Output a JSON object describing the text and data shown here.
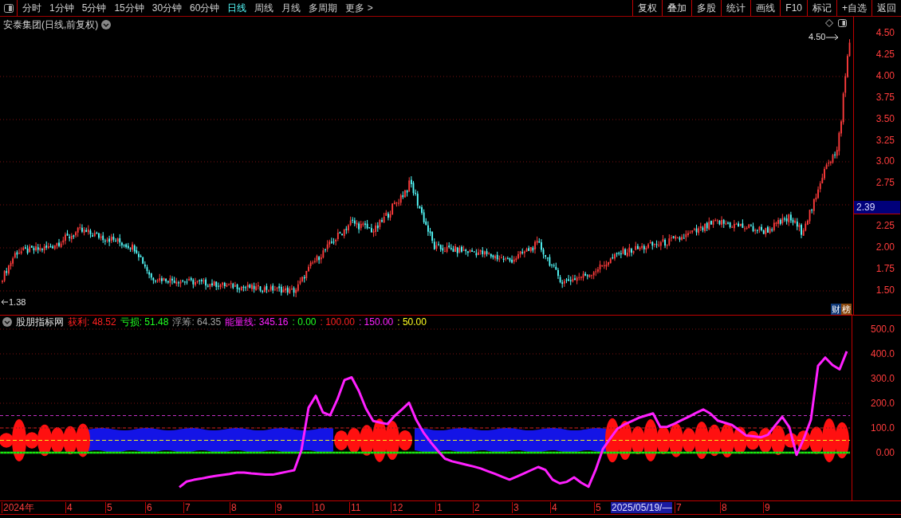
{
  "toolbar": {
    "periods": [
      {
        "label": "分时",
        "selected": false
      },
      {
        "label": "1分钟",
        "selected": false
      },
      {
        "label": "5分钟",
        "selected": false
      },
      {
        "label": "15分钟",
        "selected": false
      },
      {
        "label": "30分钟",
        "selected": false
      },
      {
        "label": "60分钟",
        "selected": false
      },
      {
        "label": "日线",
        "selected": true
      },
      {
        "label": "周线",
        "selected": false
      },
      {
        "label": "月线",
        "selected": false
      },
      {
        "label": "多周期",
        "selected": false
      },
      {
        "label": "更多 >",
        "selected": false
      }
    ],
    "actions": [
      "复权",
      "叠加",
      "多股",
      "统计",
      "画线",
      "F10",
      "标记",
      "+自选",
      "返回"
    ]
  },
  "price_chart": {
    "title": "安泰集团(日线,前复权)",
    "ticks": [
      "4.50",
      "4.25",
      "4.00",
      "3.75",
      "3.50",
      "3.25",
      "3.00",
      "2.75",
      "2.25",
      "2.00",
      "1.75",
      "1.50"
    ],
    "current_price": "2.39",
    "high_label": "4.50",
    "low_label": "1.38",
    "badge": [
      "财",
      "榜"
    ]
  },
  "indicator": {
    "name": "股朋指标网",
    "readings": [
      {
        "kind": "plain",
        "label": "获利",
        "value": ": 48.52",
        "color": "#ff2020"
      },
      {
        "kind": "plain",
        "label": "亏损",
        "value": ": 51.48",
        "color": "#20ff20"
      },
      {
        "kind": "plain",
        "label": "浮筹",
        "value": ": 64.35",
        "color": "#a0a0a0"
      },
      {
        "kind": "series",
        "value": ": 345.16",
        "color": "#ff20ff"
      },
      {
        "kind": "plain",
        "value": ": 0.00",
        "color": "#20ff20"
      },
      {
        "kind": "plain",
        "value": ": 100.00",
        "color": "#ff2020"
      },
      {
        "kind": "plain",
        "value": ": 150.00",
        "color": "#ff20ff"
      },
      {
        "kind": "plain",
        "value": ": 50.00",
        "color": "#ffff20"
      }
    ],
    "chart_data": {
      "type": "line",
      "grid": true,
      "ylim": [
        -193.5,
        506.5
      ],
      "yticks": [
        {
          "value": 500,
          "label": "500.0"
        },
        {
          "value": 400,
          "label": "400.0"
        },
        {
          "value": 300,
          "label": "300.0"
        },
        {
          "value": 200,
          "label": "200.0"
        },
        {
          "value": 100,
          "label": "100.0"
        },
        {
          "value": 0,
          "label": "0.00"
        }
      ],
      "series": [
        {
          "name": "能量线",
          "color": "#ff20ff",
          "values": [
            null,
            null,
            null,
            null,
            null,
            null,
            null,
            null,
            null,
            null,
            null,
            null,
            null,
            null,
            null,
            null,
            null,
            null,
            null,
            null,
            null,
            null,
            null,
            null,
            null,
            -140,
            -117,
            -110,
            -105,
            -99,
            -94,
            -90,
            -86,
            -81,
            -81,
            -84,
            -86,
            -89,
            -89,
            -83,
            -77,
            -71,
            10,
            182,
            230,
            163,
            151,
            215,
            294,
            305,
            250,
            178,
            128,
            122,
            116,
            149,
            175,
            202,
            133,
            82,
            43,
            8,
            -24,
            -35,
            -42,
            -49,
            -56,
            -64,
            -75,
            -86,
            -98,
            -109,
            -97,
            -84,
            -71,
            -58,
            -70,
            -109,
            -124,
            -118,
            -100,
            -122,
            -138,
            -70,
            14,
            56,
            96,
            114,
            127,
            141,
            150,
            159,
            104,
            105,
            117,
            132,
            146,
            161,
            175,
            158,
            130,
            121,
            112,
            91,
            69,
            66,
            62,
            72,
            109,
            145,
            103,
            -9,
            56,
            133,
            352,
            385,
            355,
            337,
            410
          ]
        }
      ]
    }
  },
  "x_axis": {
    "labels": [
      "2024年",
      "4",
      "5",
      "6",
      "7",
      "8",
      "9",
      "10",
      "11",
      "12",
      "1",
      "2",
      "3",
      "4",
      "5",
      "7",
      "8",
      "9"
    ],
    "cursor_label": "2025/05/19/—"
  }
}
